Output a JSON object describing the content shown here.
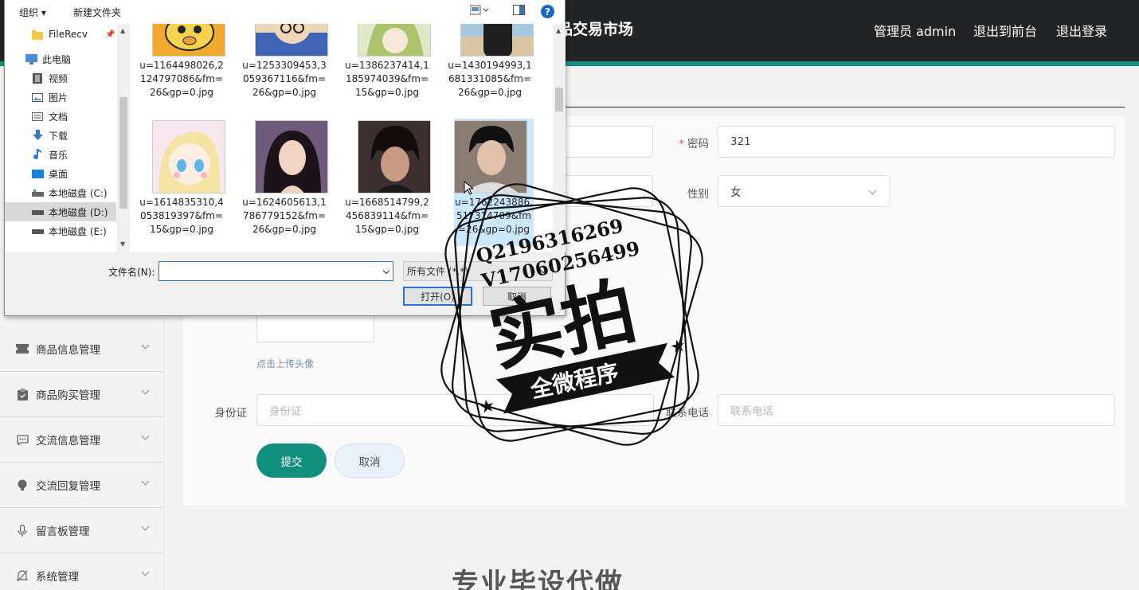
{
  "header": {
    "site_title": "商品交易市场",
    "site_title_visible": "品交易市场",
    "admin_label": "管理员 admin",
    "to_front_label": "退出到前台",
    "logout_label": "退出登录",
    "accent_color": "#17907f"
  },
  "sidebar": {
    "items": [
      {
        "label": "商品信息管理",
        "icon": "ticket-icon"
      },
      {
        "label": "商品购买管理",
        "icon": "clipboard-icon"
      },
      {
        "label": "交流信息管理",
        "icon": "chat-icon"
      },
      {
        "label": "交流回复管理",
        "icon": "bulb-icon"
      },
      {
        "label": "留言板管理",
        "icon": "microphone-icon"
      },
      {
        "label": "系统管理",
        "icon": "bell-off-icon"
      }
    ]
  },
  "form": {
    "password_label": "密码",
    "password_value": "321",
    "gender_label": "性别",
    "gender_value": "女",
    "upload_hint": "点击上传头像",
    "idcard_label": "身份证",
    "idcard_placeholder": "身份证",
    "phone_label": "联系电话",
    "phone_placeholder": "联系电话",
    "submit_label": "提交",
    "cancel_label": "取消"
  },
  "footer_text": "专业毕设代做",
  "dialog": {
    "organize_label": "组织 ▾",
    "new_folder_label": "新建文件夹",
    "help_label": "?",
    "nav_items": [
      {
        "label": "FileRecv",
        "icon": "folder-icon"
      },
      {
        "label": "此电脑",
        "icon": "computer-icon"
      },
      {
        "label": "视频",
        "icon": "video-icon"
      },
      {
        "label": "图片",
        "icon": "picture-icon"
      },
      {
        "label": "文档",
        "icon": "document-icon"
      },
      {
        "label": "下载",
        "icon": "download-icon"
      },
      {
        "label": "音乐",
        "icon": "music-icon"
      },
      {
        "label": "桌面",
        "icon": "desktop-icon"
      },
      {
        "label": "本地磁盘 (C:)",
        "icon": "drive-icon"
      },
      {
        "label": "本地磁盘 (D:)",
        "icon": "drive-icon"
      },
      {
        "label": "本地磁盘 (E:)",
        "icon": "drive-icon"
      }
    ],
    "files_row1": [
      "u=1164498026,2124797086&fm=26&gp=0.jpg",
      "u=1253309453,3059367116&fm=26&gp=0.jpg",
      "u=1386237414,1185974039&fm=15&gp=0.jpg",
      "u=1430194993,1681331085&fm=26&gp=0.jpg"
    ],
    "files_row2": [
      "u=1614835310,4053819397&fm=15&gp=0.jpg",
      "u=1624605613,1786779152&fm=26&gp=0.jpg",
      "u=1668514799,2456839114&fm=15&gp=0.jpg",
      "u=1762243886,517314709&fm=26&gp=0.jpg"
    ],
    "filename_label": "文件名(N):",
    "filename_value": "",
    "filetype_value": "所有文件 (*.*)",
    "open_label": "打开(O)",
    "cancel_label": "取消"
  },
  "watermark": {
    "qq": "Q2196316269",
    "vx": "V17060256499",
    "main": "实拍",
    "ribbon": "全微程序"
  }
}
